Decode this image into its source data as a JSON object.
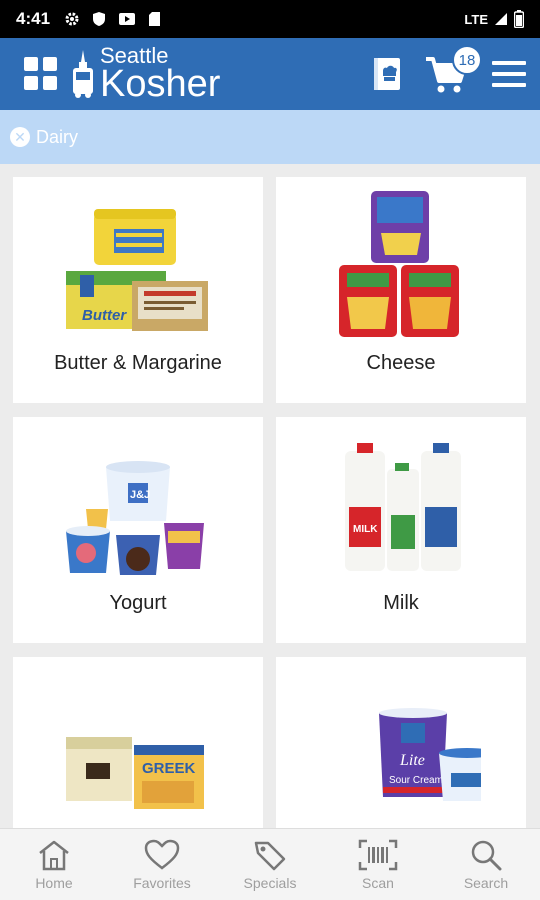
{
  "status": {
    "time": "4:41",
    "network": "LTE"
  },
  "brand": {
    "line1": "Seattle",
    "line2": "Kosher"
  },
  "cart": {
    "count": "18"
  },
  "filter": {
    "label": "Dairy"
  },
  "categories": [
    {
      "label": "Butter & Margarine"
    },
    {
      "label": "Cheese"
    },
    {
      "label": "Yogurt"
    },
    {
      "label": "Milk"
    },
    {
      "label": ""
    },
    {
      "label": ""
    }
  ],
  "product_text": {
    "butter_box": "Butter",
    "greek": "GREEK",
    "lite": "Lite",
    "sour_cream": "Sour Cream",
    "milk": "MILK",
    "jj": "J&J"
  },
  "nav": [
    {
      "label": "Home",
      "icon": "home-icon"
    },
    {
      "label": "Favorites",
      "icon": "heart-icon"
    },
    {
      "label": "Specials",
      "icon": "tag-icon"
    },
    {
      "label": "Scan",
      "icon": "barcode-icon"
    },
    {
      "label": "Search",
      "icon": "search-icon"
    }
  ]
}
